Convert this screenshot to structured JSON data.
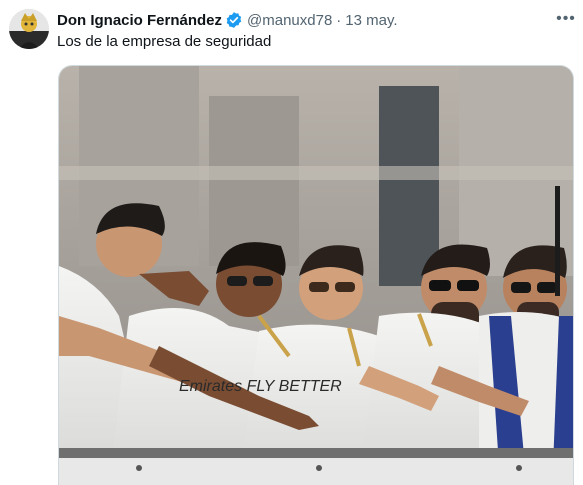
{
  "post": {
    "author_name": "Don Ignacio Fernández",
    "handle": "@manuxd78",
    "separator": "·",
    "date": "13 may.",
    "text": "Los de la empresa de seguridad",
    "more_label": "•••"
  },
  "icons": {
    "verified": "verified-badge-icon",
    "more": "more-options-icon"
  },
  "colors": {
    "verified_blue": "#1d9bf0",
    "secondary_text": "#536471",
    "primary_text": "#0f1419"
  },
  "media": {
    "jersey_print": "Emirates FLY BETTER"
  }
}
